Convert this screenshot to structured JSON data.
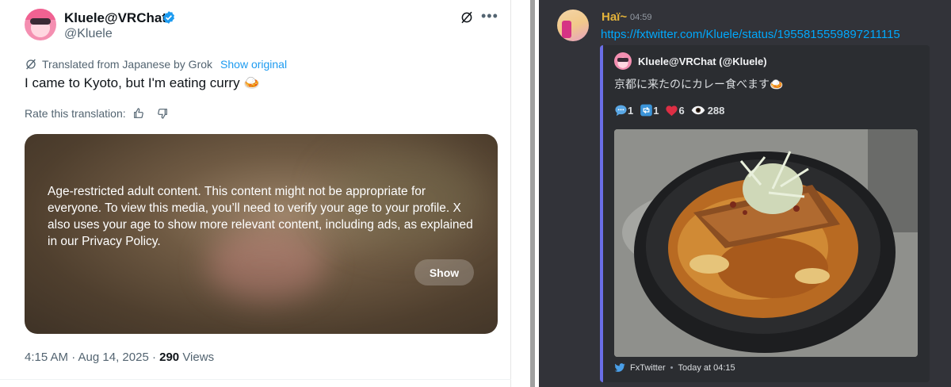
{
  "tweet": {
    "display_name": "Kluele@VRChat",
    "handle": "@Kluele",
    "translated_label": "Translated from Japanese by Grok",
    "show_original": "Show original",
    "text": "I came to Kyoto, but I'm eating curry 🍛",
    "rate_label": "Rate this translation:",
    "media_warning": "Age-restricted adult content. This content might not be appropriate for everyone. To view this media, you’ll need to verify your age to your profile. X also uses your age to show more relevant content, including ads, as explained in our Privacy Policy.",
    "show_button": "Show",
    "timestamp": "4:15 AM · Aug 14, 2025 · ",
    "views_count": "290",
    "views_label": " Views",
    "icons": [
      "verified-badge-icon",
      "grok-icon",
      "more-icon",
      "thumbs-up-icon",
      "thumbs-down-icon"
    ],
    "colors": {
      "link": "#1d9bf0",
      "verified": "#1d9bf0"
    }
  },
  "discord": {
    "author": "Haï~",
    "time": "04:59",
    "link": "https://fxtwitter.com/Kluele/status/1955815559897211115",
    "embed": {
      "author": "Kluele@VRChat (@Kluele)",
      "text": "京都に来たのにカレー食べます🍛",
      "replies": "1",
      "retweets": "1",
      "likes": "6",
      "views": "288",
      "footer_source": "FxTwitter",
      "footer_sep": "•",
      "footer_time": "Today at 04:15",
      "accent_color": "#6a6ee7"
    },
    "colors": {
      "author": "#e4b33a",
      "link": "#00a8fc",
      "background": "#323339"
    }
  }
}
